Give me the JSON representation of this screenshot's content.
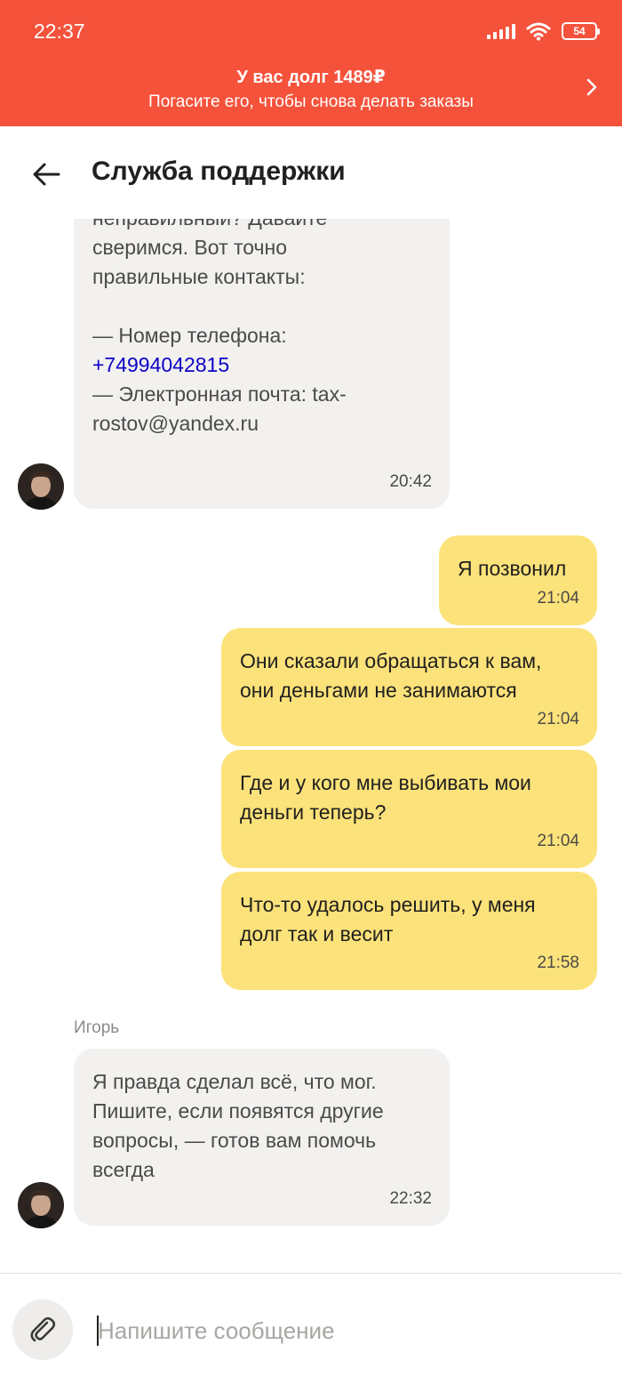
{
  "status_bar": {
    "time": "22:37",
    "battery": "54"
  },
  "banner": {
    "title": "У вас долг 1489₽",
    "subtitle": "Погасите его, чтобы снова делать заказы",
    "color": "#f5523b"
  },
  "header": {
    "title": "Служба поддержки"
  },
  "messages": [
    {
      "direction": "in",
      "text_top": "Может быть, номер был\nнеправильный? Давайте\nсверимся. Вот точно\nправильные контакты:\n\n— Номер телефона:",
      "phone": "+74994042815",
      "text_bottom": "— Электронная почта: tax-\nrostov@yandex.ru",
      "time": "20:42"
    },
    {
      "direction": "out",
      "text": "Я позвонил",
      "time": "21:04"
    },
    {
      "direction": "out",
      "text": "Они сказали обращаться к вам,\nони деньгами не занимаются",
      "time": "21:04"
    },
    {
      "direction": "out",
      "text": "Где и у кого мне выбивать мои\nденьги теперь?",
      "time": "21:04"
    },
    {
      "direction": "out",
      "text": "Что-то удалось решить, у меня\nдолг так и весит",
      "time": "21:58"
    },
    {
      "direction": "in",
      "sender": "Игорь",
      "text": "Я правда сделал всё, что мог.\nПишите, если появятся другие\nвопросы, — готов вам помочь\nвсегда",
      "time": "22:32"
    }
  ],
  "composer": {
    "placeholder": "Напишите сообщение"
  },
  "colors": {
    "incoming_bubble": "#f2f1ef",
    "outgoing_bubble": "#fce27a",
    "link": "#0b00c8"
  }
}
